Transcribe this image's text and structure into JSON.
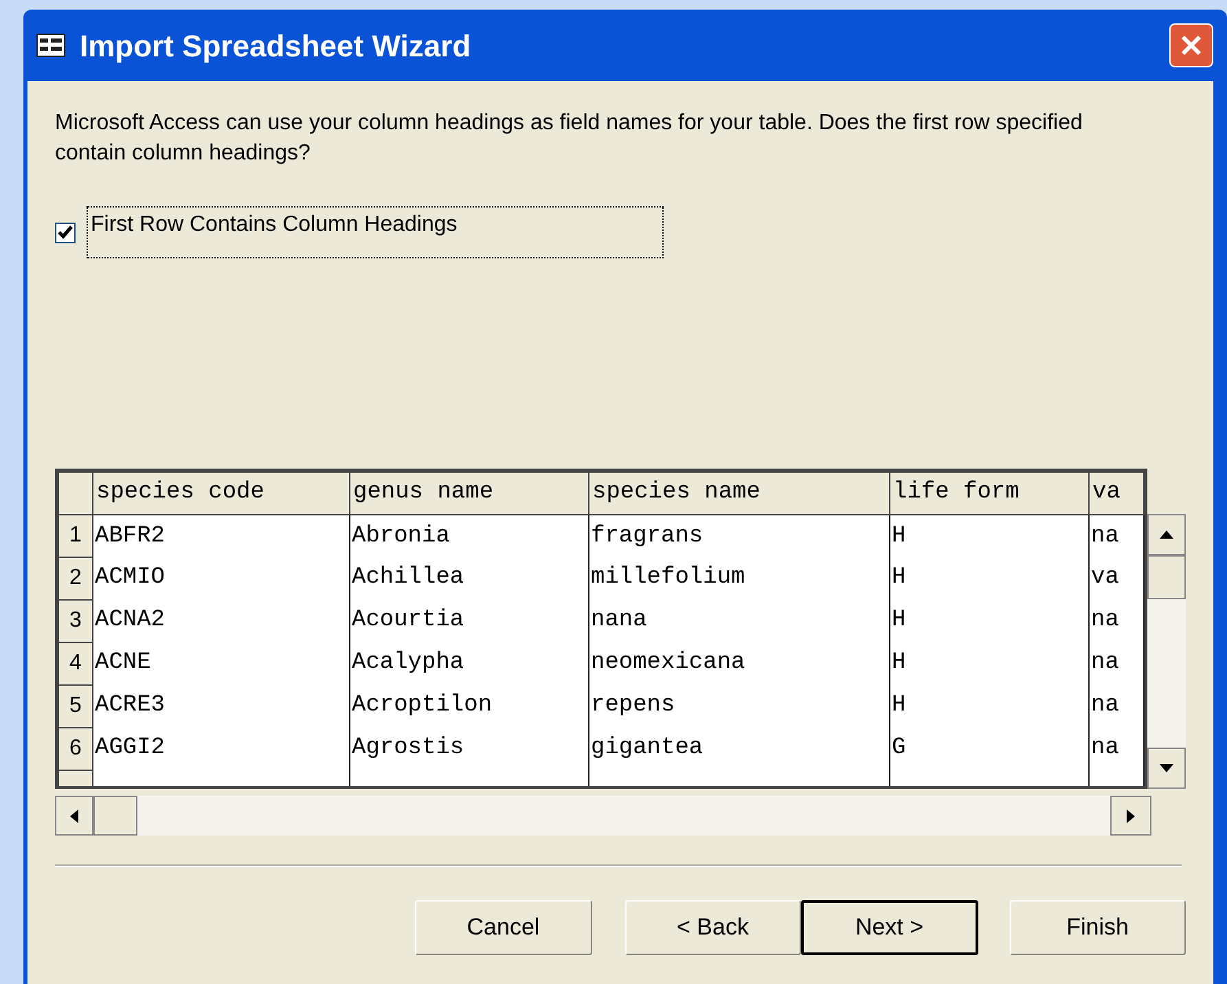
{
  "window": {
    "title": "Import Spreadsheet Wizard"
  },
  "instructions": "Microsoft Access can use your column headings as field names for your table. Does the first row specified contain column headings?",
  "checkbox": {
    "label": "First Row Contains Column Headings",
    "checked": true
  },
  "grid": {
    "columns": [
      "species code",
      "genus name",
      "species name",
      "life form",
      "va"
    ],
    "rows": [
      {
        "number": "1",
        "cells": [
          "ABFR2",
          "Abronia",
          "fragrans",
          "H",
          "na"
        ]
      },
      {
        "number": "2",
        "cells": [
          "ACMIO",
          "Achillea",
          "millefolium",
          "H",
          "va"
        ]
      },
      {
        "number": "3",
        "cells": [
          "ACNA2",
          "Acourtia",
          "nana",
          "H",
          "na"
        ]
      },
      {
        "number": "4",
        "cells": [
          "ACNE",
          "Acalypha",
          "neomexicana",
          "H",
          "na"
        ]
      },
      {
        "number": "5",
        "cells": [
          "ACRE3",
          "Acroptilon",
          "repens",
          "H",
          "na"
        ]
      },
      {
        "number": "6",
        "cells": [
          "AGGI2",
          "Agrostis",
          "gigantea",
          "G",
          "na"
        ]
      }
    ]
  },
  "buttons": [
    {
      "label": "Cancel",
      "default": false
    },
    {
      "label": "< Back",
      "default": false
    },
    {
      "label": "Next >",
      "default": true
    },
    {
      "label": "Finish",
      "default": false
    }
  ]
}
